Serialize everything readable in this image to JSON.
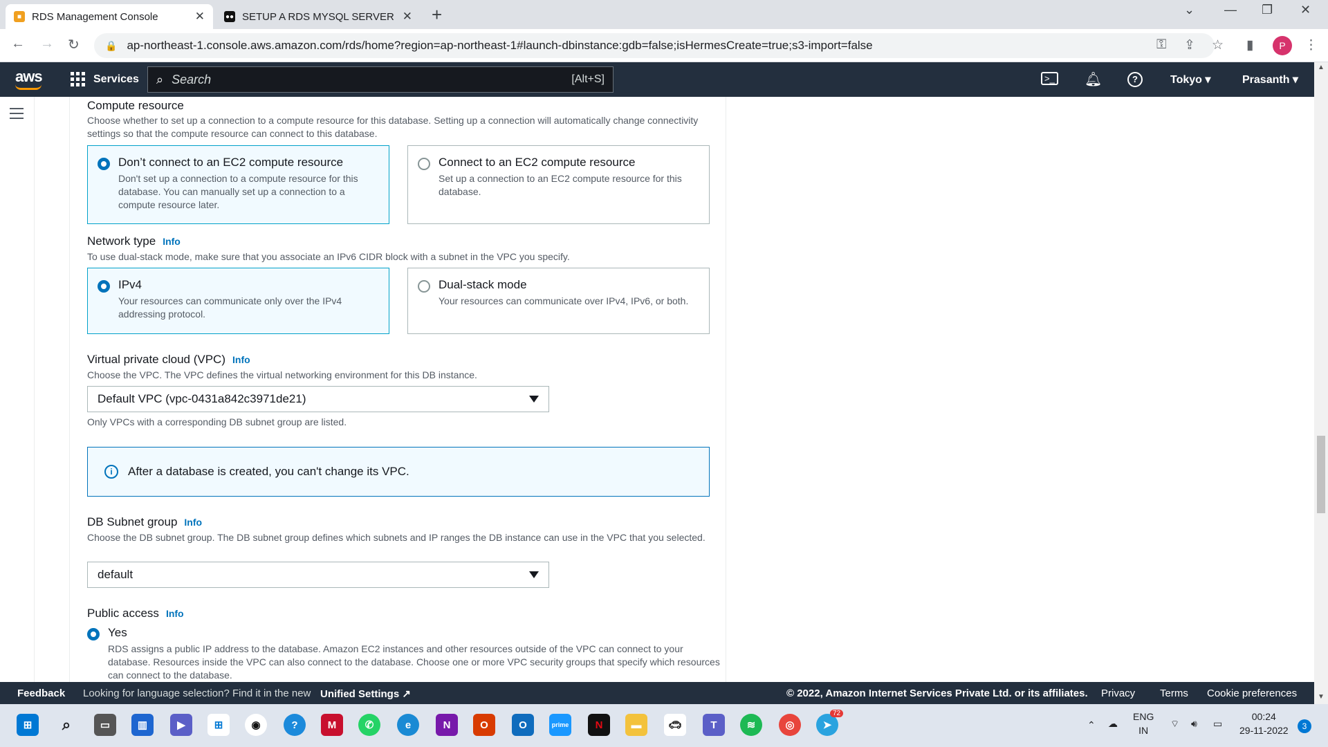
{
  "browser": {
    "tabs": [
      {
        "title": "RDS Management Console",
        "active": true
      },
      {
        "title": "SETUP A RDS MYSQL SERVER IN",
        "active": false
      }
    ],
    "url": "ap-northeast-1.console.aws.amazon.com/rds/home?region=ap-northeast-1#launch-dbinstance:gdb=false;isHermesCreate=true;s3-import=false",
    "profile_initial": "P"
  },
  "aws_header": {
    "logo": "aws",
    "services": "Services",
    "search_placeholder": "Search",
    "search_shortcut": "[Alt+S]",
    "region": "Tokyo",
    "user": "Prasanth"
  },
  "compute": {
    "label": "Compute resource",
    "desc": "Choose whether to set up a connection to a compute resource for this database. Setting up a connection will automatically change connectivity settings so that the compute resource can connect to this database.",
    "options": [
      {
        "title": "Don’t connect to an EC2 compute resource",
        "desc": "Don't set up a connection to a compute resource for this database. You can manually set up a connection to a compute resource later.",
        "selected": true
      },
      {
        "title": "Connect to an EC2 compute resource",
        "desc": "Set up a connection to an EC2 compute resource for this database.",
        "selected": false
      }
    ]
  },
  "network": {
    "label": "Network type",
    "info": "Info",
    "desc": "To use dual-stack mode, make sure that you associate an IPv6 CIDR block with a subnet in the VPC you specify.",
    "options": [
      {
        "title": "IPv4",
        "desc": "Your resources can communicate only over the IPv4 addressing protocol.",
        "selected": true
      },
      {
        "title": "Dual-stack mode",
        "desc": "Your resources can communicate over IPv4, IPv6, or both.",
        "selected": false
      }
    ]
  },
  "vpc": {
    "label": "Virtual private cloud (VPC)",
    "info": "Info",
    "desc": "Choose the VPC. The VPC defines the virtual networking environment for this DB instance.",
    "value": "Default VPC (vpc-0431a842c3971de21)",
    "hint": "Only VPCs with a corresponding DB subnet group are listed.",
    "alert": "After a database is created, you can't change its VPC."
  },
  "subnet": {
    "label": "DB Subnet group",
    "info": "Info",
    "desc": "Choose the DB subnet group. The DB subnet group defines which subnets and IP ranges the DB instance can use in the VPC that you selected.",
    "value": "default"
  },
  "public_access": {
    "label": "Public access",
    "info": "Info",
    "yes_label": "Yes",
    "yes_desc": "RDS assigns a public IP address to the database. Amazon EC2 instances and other resources outside of the VPC can connect to your database. Resources inside the VPC can also connect to the database. Choose one or more VPC security groups that specify which resources can connect to the database.",
    "selected": "Yes"
  },
  "footer": {
    "feedback": "Feedback",
    "lang_text": "Looking for language selection? Find it in the new",
    "unified": "Unified Settings",
    "copyright": "© 2022, Amazon Internet Services Private Ltd. or its affiliates.",
    "privacy": "Privacy",
    "terms": "Terms",
    "cookies": "Cookie preferences"
  },
  "taskbar": {
    "lang": "ENG",
    "region": "IN",
    "time": "00:24",
    "date": "29-11-2022",
    "notifications": "3",
    "telegram_badge": "72"
  },
  "colors": {
    "aws_dark": "#232f3e",
    "accent": "#0073bb",
    "aws_orange": "#ff9900"
  }
}
